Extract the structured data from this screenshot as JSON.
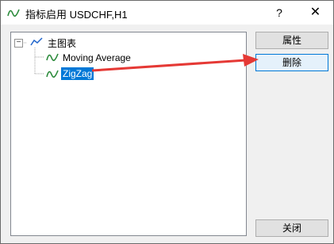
{
  "window": {
    "title": "指标启用 USDCHF,H1",
    "help_label": "?",
    "close_label": "✕"
  },
  "tree": {
    "root": {
      "label": "主图表",
      "expander": "−"
    },
    "children": [
      {
        "label": "Moving Average",
        "selected": false
      },
      {
        "label": "ZigZag",
        "selected": true
      }
    ]
  },
  "buttons": {
    "properties": "属性",
    "delete": "删除",
    "close": "关闭"
  },
  "colors": {
    "selection": "#0078d7",
    "annotation_arrow": "#e53935"
  }
}
